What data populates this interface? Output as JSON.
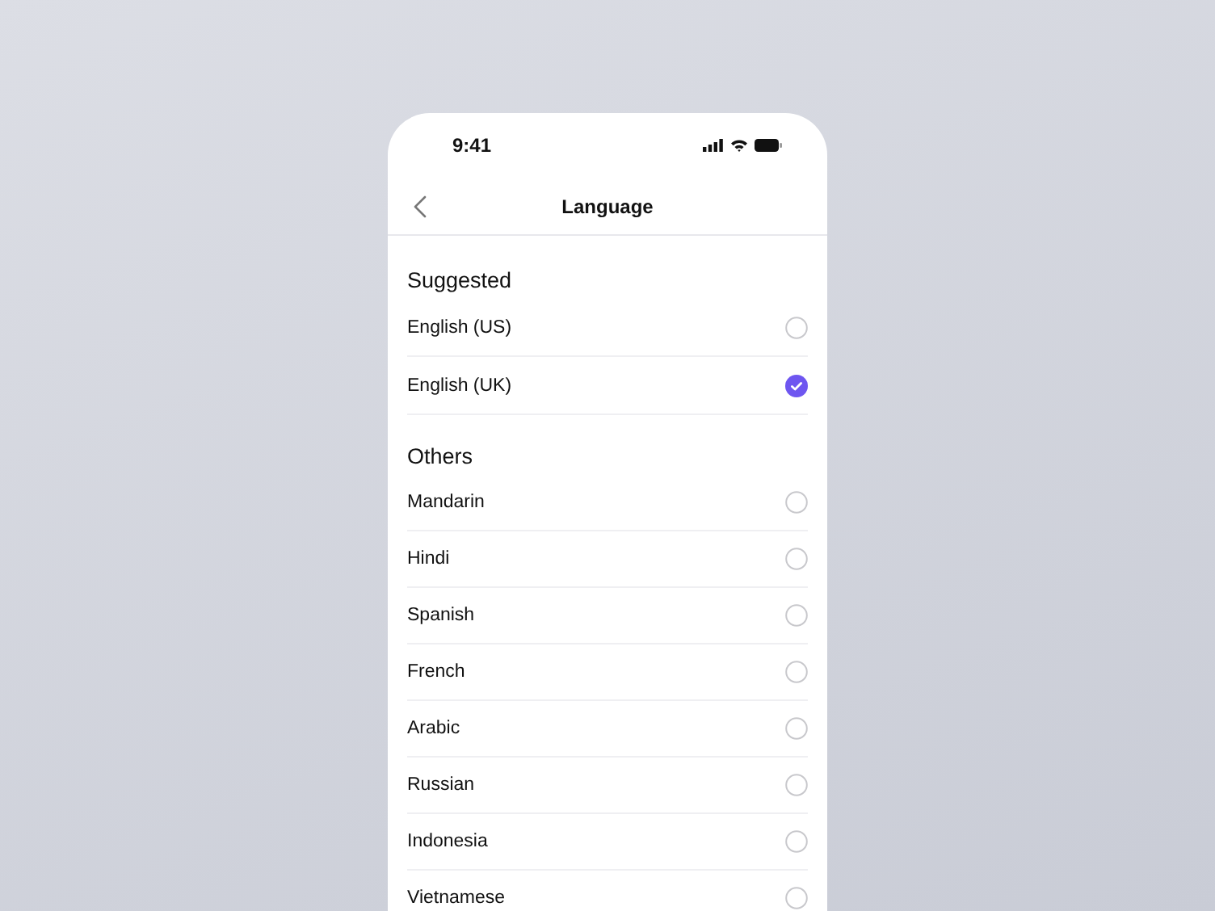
{
  "status_bar": {
    "time": "9:41"
  },
  "header": {
    "title": "Language"
  },
  "sections": [
    {
      "title": "Suggested",
      "items": [
        {
          "label": "English (US)",
          "selected": false
        },
        {
          "label": "English (UK)",
          "selected": true
        }
      ]
    },
    {
      "title": "Others",
      "items": [
        {
          "label": "Mandarin",
          "selected": false
        },
        {
          "label": "Hindi",
          "selected": false
        },
        {
          "label": "Spanish",
          "selected": false
        },
        {
          "label": "French",
          "selected": false
        },
        {
          "label": "Arabic",
          "selected": false
        },
        {
          "label": "Russian",
          "selected": false
        },
        {
          "label": "Indonesia",
          "selected": false
        },
        {
          "label": "Vietnamese",
          "selected": false
        }
      ]
    }
  ]
}
